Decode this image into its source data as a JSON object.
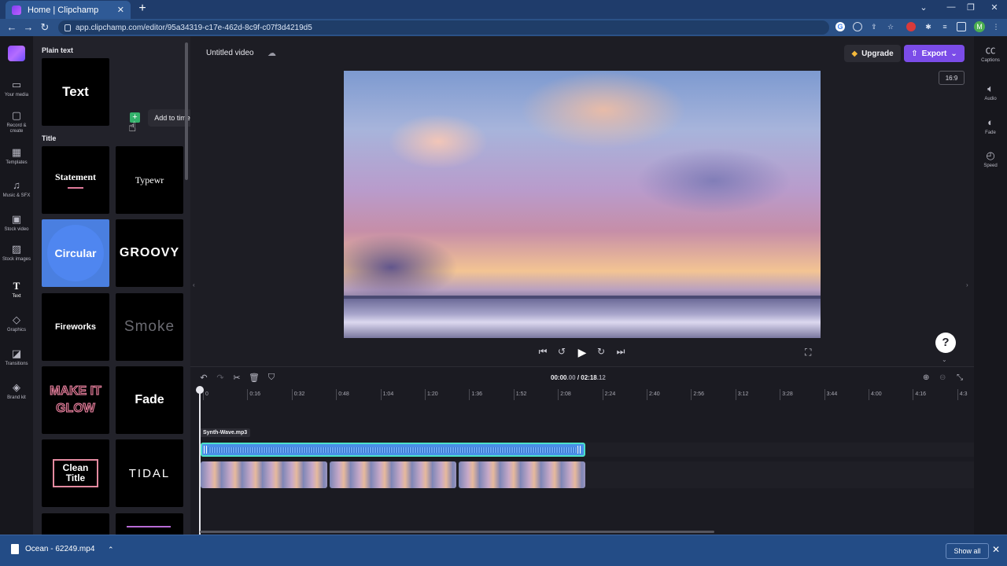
{
  "browser": {
    "tab_title": "Home | Clipchamp",
    "tab_close": "✕",
    "new_tab": "+",
    "url": "app.clipchamp.com/editor/95a34319-c17e-462d-8c9f-c07f3d4219d5",
    "profile_initial": "M"
  },
  "leftnav": {
    "items": [
      {
        "label": "Your media",
        "icon": "folder-icon"
      },
      {
        "label": "Record & create",
        "icon": "camera-icon"
      },
      {
        "label": "Templates",
        "icon": "templates-icon"
      },
      {
        "label": "Music & SFX",
        "icon": "music-icon"
      },
      {
        "label": "Stock video",
        "icon": "film-icon"
      },
      {
        "label": "Stock images",
        "icon": "image-icon"
      },
      {
        "label": "Text",
        "icon": "text-icon"
      },
      {
        "label": "Graphics",
        "icon": "shapes-icon"
      },
      {
        "label": "Transitions",
        "icon": "transitions-icon"
      },
      {
        "label": "Brand kit",
        "icon": "brand-icon"
      }
    ]
  },
  "library": {
    "plain_text_heading": "Plain text",
    "title_heading": "Title",
    "tooltip": "Add to timeline",
    "add_symbol": "+",
    "cards": {
      "text": "Text",
      "statement": "Statement",
      "typewriter": "Typewr",
      "circular": "Circular",
      "groovy": "GROOVY",
      "fireworks": "Fireworks",
      "smoke": "Smoke",
      "glow": "MAKE IT GLOW",
      "fade": "Fade",
      "clean_title": "Clean Title",
      "tidal": "TIDAL"
    }
  },
  "editor": {
    "project_title": "Untitled video",
    "upgrade_label": "Upgrade",
    "export_label": "Export",
    "aspect_ratio": "16:9",
    "help_symbol": "?"
  },
  "timeline": {
    "current_time": "00:00",
    "current_frac": ".00",
    "separator": " / ",
    "total_time": "02:18",
    "total_frac": ".12",
    "ticks": [
      "0",
      "0:16",
      "0:32",
      "0:48",
      "1:04",
      "1:20",
      "1:36",
      "1:52",
      "2:08",
      "2:24",
      "2:40",
      "2:56",
      "3:12",
      "3:28",
      "3:44",
      "4:00",
      "4:16",
      "4:3"
    ],
    "audio_clip_name": "Synth-Wave.mp3"
  },
  "rightnav": {
    "items": [
      {
        "label": "Captions",
        "icon": "captions-icon"
      },
      {
        "label": "Audio",
        "icon": "speaker-icon"
      },
      {
        "label": "Fade",
        "icon": "fade-icon"
      },
      {
        "label": "Speed",
        "icon": "speed-icon"
      }
    ]
  },
  "downloads": {
    "file_name": "Ocean - 62249.mp4",
    "show_all": "Show all"
  },
  "colors": {
    "accent": "#7b4ce8",
    "audio_clip": "#4a8ee8",
    "add_button": "#33b26b"
  }
}
